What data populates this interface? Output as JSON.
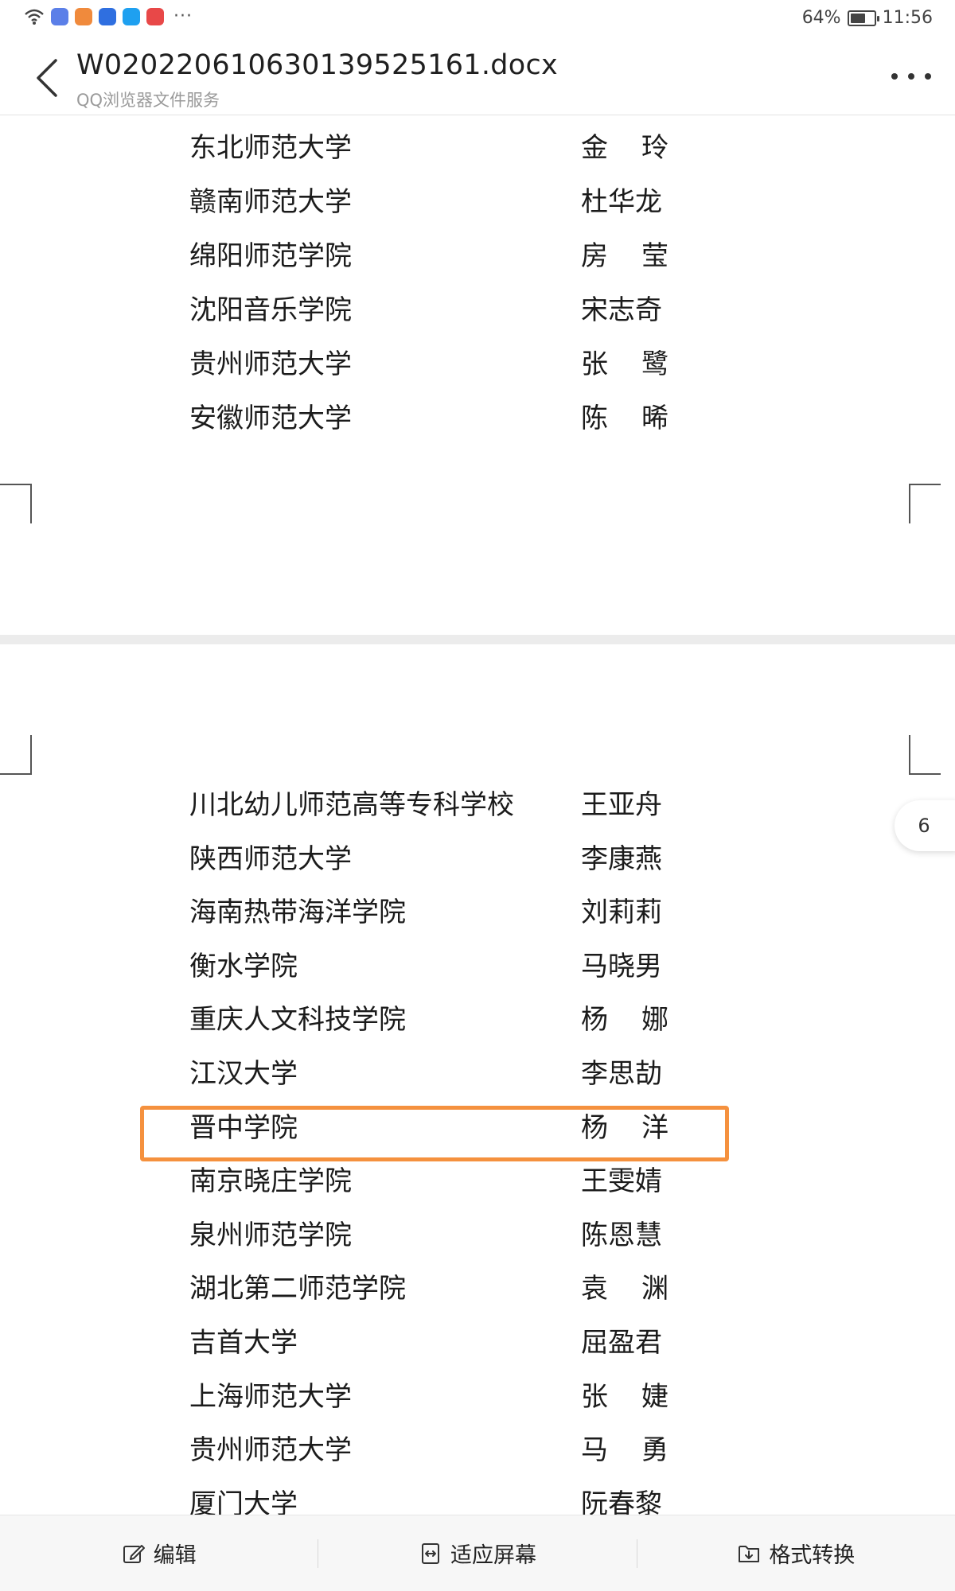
{
  "status_bar": {
    "battery_text": "64%",
    "battery_level": 0.64,
    "time": "11:56",
    "notification_icons": [
      "wifi-icon",
      "music-app-icon",
      "video-app-icon",
      "lightbulb-app-icon",
      "qq-browser-icon",
      "red-app-icon"
    ],
    "more_glyph": "···"
  },
  "header": {
    "title": "W020220610630139525161.docx",
    "subtitle": "QQ浏览器文件服务"
  },
  "page_indicator": "6",
  "rows_page_top": [
    {
      "school": "东北师范大学",
      "person": [
        "金",
        "玲"
      ]
    },
    {
      "school": "赣南师范大学",
      "person": [
        "杜华龙"
      ]
    },
    {
      "school": "绵阳师范学院",
      "person": [
        "房",
        "莹"
      ]
    },
    {
      "school": "沈阳音乐学院",
      "person": [
        "宋志奇"
      ]
    },
    {
      "school": "贵州师范大学",
      "person": [
        "张",
        "鹭"
      ]
    },
    {
      "school": "安徽师范大学",
      "person": [
        "陈",
        "晞"
      ]
    }
  ],
  "rows_page_bottom": [
    {
      "school": "川北幼儿师范高等专科学校",
      "person": [
        "王亚舟"
      ]
    },
    {
      "school": "陕西师范大学",
      "person": [
        "李康燕"
      ]
    },
    {
      "school": "海南热带海洋学院",
      "person": [
        "刘莉莉"
      ]
    },
    {
      "school": "衡水学院",
      "person": [
        "马晓男"
      ]
    },
    {
      "school": "重庆人文科技学院",
      "person": [
        "杨",
        "娜"
      ]
    },
    {
      "school": "江汉大学",
      "person": [
        "李思劼"
      ]
    },
    {
      "school": "晋中学院",
      "person": [
        "杨",
        "洋"
      ]
    },
    {
      "school": "南京晓庄学院",
      "person": [
        "王雯婧"
      ]
    },
    {
      "school": "泉州师范学院",
      "person": [
        "陈恩慧"
      ]
    },
    {
      "school": "湖北第二师范学院",
      "person": [
        "袁",
        "渊"
      ]
    },
    {
      "school": "吉首大学",
      "person": [
        "屈盈君"
      ]
    },
    {
      "school": "上海师范大学",
      "person": [
        "张",
        "婕"
      ]
    },
    {
      "school": "贵州师范大学",
      "person": [
        "马",
        "勇"
      ]
    },
    {
      "school": "厦门大学",
      "person": [
        "阮春黎"
      ]
    }
  ],
  "toolbar": {
    "edit_label": "编辑",
    "fit_label": "适应屏幕",
    "convert_label": "格式转换"
  },
  "colors": {
    "highlight": "#f5913e",
    "page_gap": "#ececec"
  }
}
